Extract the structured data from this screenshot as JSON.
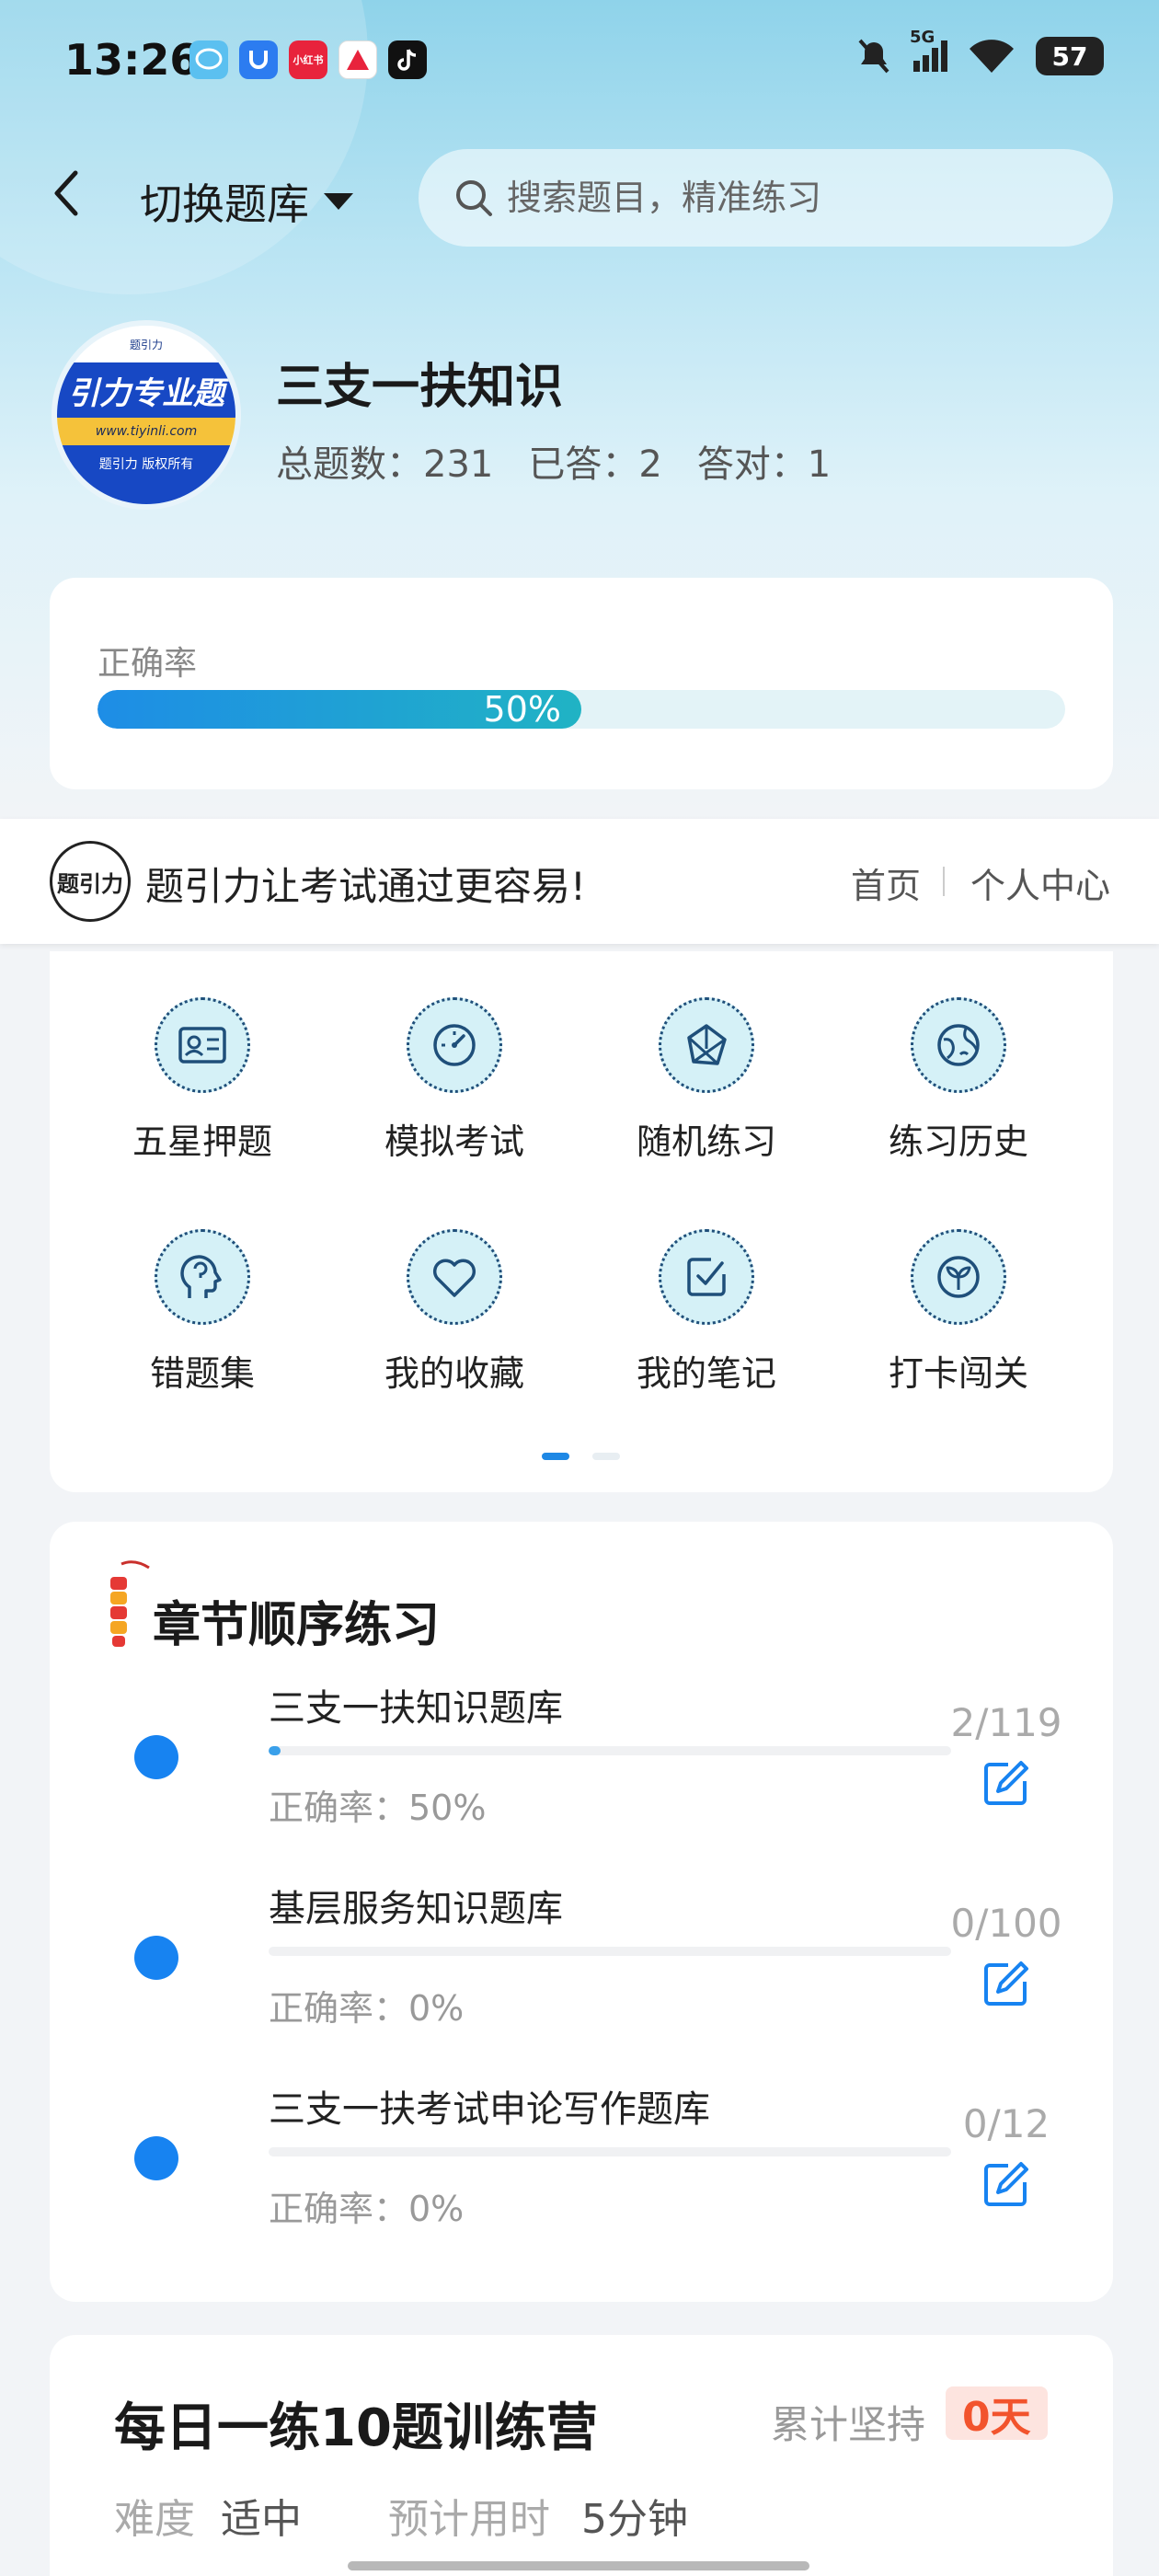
{
  "status_bar": {
    "time": "13:26",
    "apps": [
      "messages-icon",
      "security-icon",
      "xiaohongshu-icon",
      "news-icon",
      "tiktok-icon"
    ],
    "app_label_xhs": "小红书",
    "network": "5G",
    "battery": "57"
  },
  "header": {
    "bank_switch_label": "切换题库",
    "search_placeholder": "搜索题目，精准练习"
  },
  "bank": {
    "logo_top_text": "题引力",
    "logo_main_text": "引力专业题",
    "logo_url": "www.tiyinli.com",
    "logo_footer": "题引力 版权所有",
    "name": "三支一扶知识",
    "total_label": "总题数：231",
    "answered_label": "已答：2",
    "correct_label": "答对：1"
  },
  "accuracy": {
    "label": "正确率",
    "value_text": "50%",
    "value": 0.5
  },
  "banner": {
    "logo_text": "题引力",
    "slogan": "题引力让考试通过更容易!",
    "home_link": "首页",
    "profile_link": "个人中心"
  },
  "grid": {
    "items": [
      {
        "label": "五星押题",
        "icon": "id-card-icon"
      },
      {
        "label": "模拟考试",
        "icon": "speedometer-icon"
      },
      {
        "label": "随机练习",
        "icon": "shuffle-icon"
      },
      {
        "label": "练习历史",
        "icon": "globe-icon"
      },
      {
        "label": "错题集",
        "icon": "head-icon"
      },
      {
        "label": "我的收藏",
        "icon": "heart-icon"
      },
      {
        "label": "我的笔记",
        "icon": "note-check-icon"
      },
      {
        "label": "打卡闯关",
        "icon": "leaf-icon"
      }
    ]
  },
  "chapters": {
    "title": "章节顺序练习",
    "items": [
      {
        "name": "三支一扶知识题库",
        "rate": "正确率：50%",
        "count": "2/119",
        "progress": 0.017
      },
      {
        "name": "基层服务知识题库",
        "rate": "正确率：0%",
        "count": "0/100",
        "progress": 0
      },
      {
        "name": "三支一扶考试申论写作题库",
        "rate": "正确率：0%",
        "count": "0/12",
        "progress": 0
      }
    ]
  },
  "daily": {
    "title": "每日一练10题训练营",
    "streak_label": "累计坚持",
    "streak_value": "0天",
    "difficulty_label": "难度",
    "difficulty_value": "适中",
    "time_label": "预计用时",
    "time_value": "5分钟"
  },
  "colors": {
    "accent": "#1783f1",
    "progress_start": "#1e8de6",
    "progress_end": "#20b3c4",
    "streak": "#f2542d"
  }
}
